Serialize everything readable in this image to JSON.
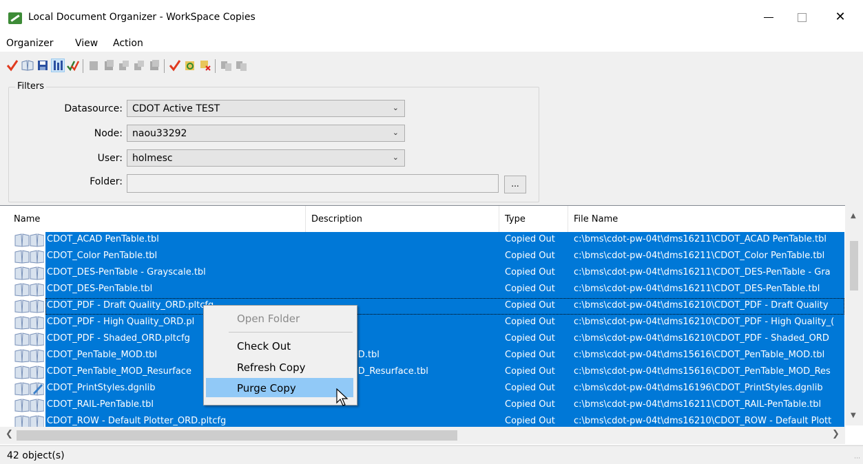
{
  "window": {
    "title": "Local Document Organizer - WorkSpace Copies"
  },
  "menubar": {
    "items": [
      "Organizer",
      "View",
      "Action"
    ]
  },
  "toolbar": {
    "buttons": [
      "check-out-icon",
      "open-book-icon",
      "save-icon",
      "properties-icon",
      "multi-check-icon",
      "doc-gray-1-icon",
      "doc-gray-2-icon",
      "doc-gray-3-icon",
      "doc-gray-4-icon",
      "doc-gray-5-icon",
      "checkmark-icon",
      "refresh-copy-icon",
      "purge-copy-icon",
      "copy-gray-1-icon",
      "copy-gray-2-icon"
    ]
  },
  "filters": {
    "title": "Filters",
    "datasource_label": "Datasource:",
    "datasource_value": "CDOT Active TEST",
    "node_label": "Node:",
    "node_value": "naou33292",
    "user_label": "User:",
    "user_value": "holmesc",
    "folder_label": "Folder:",
    "folder_value": "",
    "browse_label": "..."
  },
  "list": {
    "columns": [
      "Name",
      "Description",
      "Type",
      "File Name"
    ],
    "rows": [
      {
        "name": "CDOT_ACAD PenTable.tbl",
        "description": "",
        "type": "Copied Out",
        "file": "c:\\bms\\cdot-pw-04t\\dms16211\\CDOT_ACAD PenTable.tbl"
      },
      {
        "name": "CDOT_Color PenTable.tbl",
        "description": "",
        "type": "Copied Out",
        "file": "c:\\bms\\cdot-pw-04t\\dms16211\\CDOT_Color PenTable.tbl"
      },
      {
        "name": "CDOT_DES-PenTable - Grayscale.tbl",
        "description": "",
        "type": "Copied Out",
        "file": "c:\\bms\\cdot-pw-04t\\dms16211\\CDOT_DES-PenTable - Gra"
      },
      {
        "name": "CDOT_DES-PenTable.tbl",
        "description": "",
        "type": "Copied Out",
        "file": "c:\\bms\\cdot-pw-04t\\dms16211\\CDOT_DES-PenTable.tbl"
      },
      {
        "name": "CDOT_PDF - Draft Quality_ORD.pltcfg",
        "description": "",
        "type": "Copied Out",
        "file": "c:\\bms\\cdot-pw-04t\\dms16210\\CDOT_PDF - Draft Quality"
      },
      {
        "name": "CDOT_PDF - High Quality_ORD.pl",
        "description": "",
        "type": "Copied Out",
        "file": "c:\\bms\\cdot-pw-04t\\dms16210\\CDOT_PDF - High Quality_("
      },
      {
        "name": "CDOT_PDF - Shaded_ORD.pltcfg",
        "description": "",
        "type": "Copied Out",
        "file": "c:\\bms\\cdot-pw-04t\\dms16210\\CDOT_PDF - Shaded_ORD"
      },
      {
        "name": "CDOT_PenTable_MOD.tbl",
        "description": "nTable_MOD.tbl",
        "type": "Copied Out",
        "file": "c:\\bms\\cdot-pw-04t\\dms15616\\CDOT_PenTable_MOD.tbl"
      },
      {
        "name": "CDOT_PenTable_MOD_Resurface",
        "description": "nTable_MOD_Resurface.tbl",
        "type": "Copied Out",
        "file": "c:\\bms\\cdot-pw-04t\\dms15616\\CDOT_PenTable_MOD_Res"
      },
      {
        "name": "CDOT_PrintStyles.dgnlib",
        "description": "",
        "type": "Copied Out",
        "file": "c:\\bms\\cdot-pw-04t\\dms16196\\CDOT_PrintStyles.dgnlib"
      },
      {
        "name": "CDOT_RAIL-PenTable.tbl",
        "description": "",
        "type": "Copied Out",
        "file": "c:\\bms\\cdot-pw-04t\\dms16211\\CDOT_RAIL-PenTable.tbl"
      },
      {
        "name": "CDOT_ROW - Default Plotter_ORD.pltcfg",
        "description": "",
        "type": "Copied Out",
        "file": "c:\\bms\\cdot-pw-04t\\dms16210\\CDOT_ROW - Default Plott"
      }
    ]
  },
  "context_menu": {
    "open_folder": "Open Folder",
    "check_out": "Check Out",
    "refresh_copy": "Refresh Copy",
    "purge_copy": "Purge Copy"
  },
  "status": {
    "count": "42 object(s)"
  },
  "colors": {
    "selection": "#0078d7",
    "menu_hover": "#91c9f7",
    "check_red": "#e03a1e"
  }
}
